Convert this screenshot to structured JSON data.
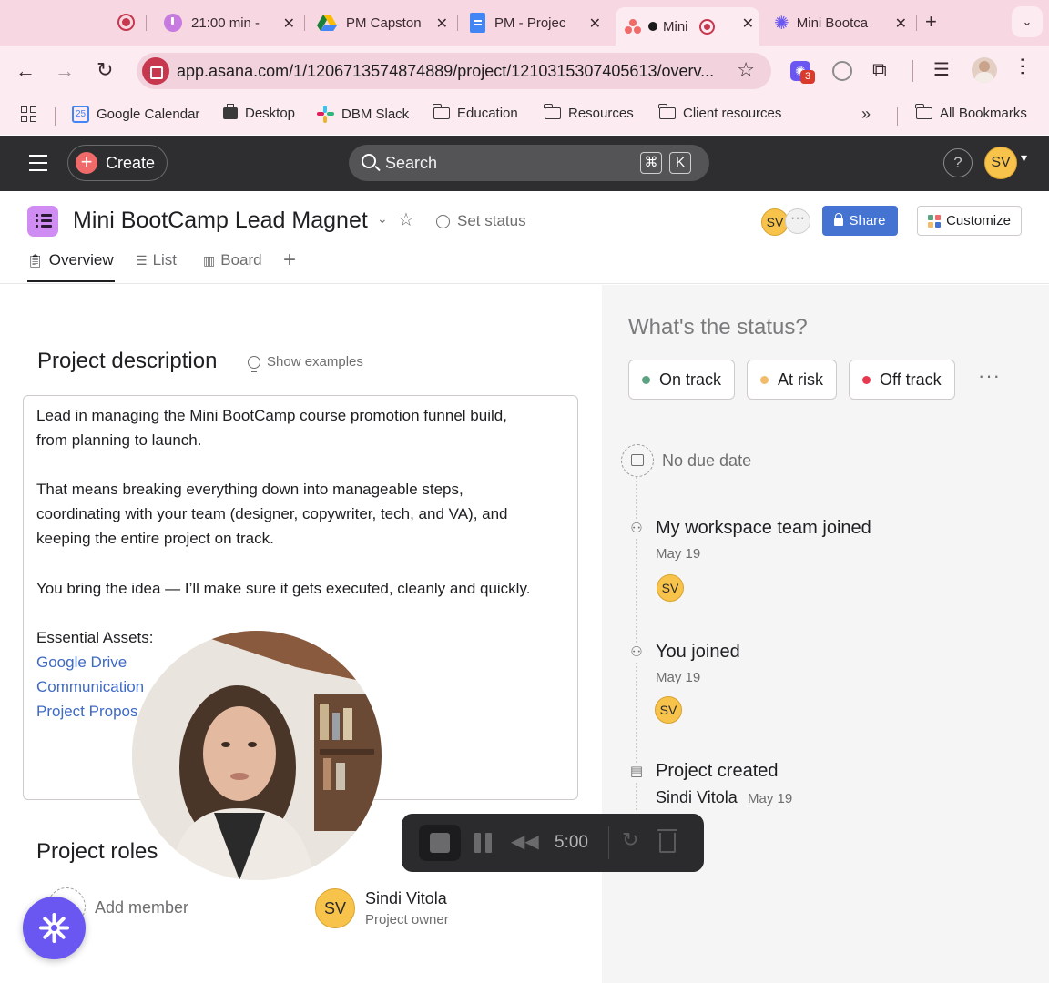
{
  "browser": {
    "tabs": [
      {
        "title": "21:00 min -"
      },
      {
        "title": "PM Capston"
      },
      {
        "title": "PM - Projec"
      },
      {
        "title": "Mini"
      },
      {
        "title": "Mini Bootca"
      }
    ],
    "url": "app.asana.com/1/1206713574874889/project/1210315307405613/overv...",
    "extension_badge": "3",
    "bookmarks": [
      {
        "label": "Google Calendar",
        "icon": "calendar-icon"
      },
      {
        "label": "Desktop",
        "icon": "briefcase-icon"
      },
      {
        "label": "DBM Slack",
        "icon": "slack-icon"
      },
      {
        "label": "Education",
        "icon": "folder-icon"
      },
      {
        "label": "Resources",
        "icon": "folder-icon"
      },
      {
        "label": "Client resources",
        "icon": "folder-icon"
      }
    ],
    "all_bookmarks": "All Bookmarks",
    "calendar_day": "25"
  },
  "asana": {
    "create_label": "Create",
    "search_placeholder": "Search",
    "search_shortcut": [
      "⌘",
      "K"
    ],
    "help_label": "?",
    "user_initials": "SV"
  },
  "project": {
    "title": "Mini BootCamp Lead Magnet",
    "set_status": "Set status",
    "share_label": "Share",
    "customize_label": "Customize",
    "tabs": [
      {
        "label": "Overview",
        "active": true
      },
      {
        "label": "List",
        "active": false
      },
      {
        "label": "Board",
        "active": false
      }
    ],
    "description_heading": "Project description",
    "show_examples": "Show examples",
    "description_lines": [
      "Lead in managing the Mini BootCamp course promotion funnel build,",
      "from planning to launch.",
      "That means breaking everything down into manageable steps,",
      "coordinating with your team (designer, copywriter, tech, and VA), and",
      "keeping the entire project on track.",
      "You bring the idea — I’ll make sure it gets executed, cleanly and quickly.",
      "Essential Assets:"
    ],
    "asset_links": [
      "Google Drive",
      "Communication",
      "Project Propos"
    ],
    "roles_heading": "Project roles",
    "add_member": "Add member",
    "owner": {
      "initials": "SV",
      "name": "Sindi Vitola",
      "role": "Project owner"
    }
  },
  "status_panel": {
    "question": "What's the status?",
    "options": [
      {
        "label": "On track",
        "color": "#5da283"
      },
      {
        "label": "At risk",
        "color": "#f1bd6c"
      },
      {
        "label": "Off track",
        "color": "#e8384f"
      }
    ],
    "more": "···",
    "due": "No due date",
    "events": [
      {
        "title": "My workspace team joined",
        "date": "May 19",
        "avatar": "SV"
      },
      {
        "title": "You joined",
        "date": "May 19",
        "avatar": "SV"
      },
      {
        "title": "Project created",
        "author": "Sindi Vitola",
        "date": "May 19"
      }
    ]
  },
  "recorder": {
    "time": "5:00"
  },
  "colors": {
    "accent": "#4573d2",
    "topbar": "#2e2e30",
    "avatar": "#f8c34a"
  }
}
